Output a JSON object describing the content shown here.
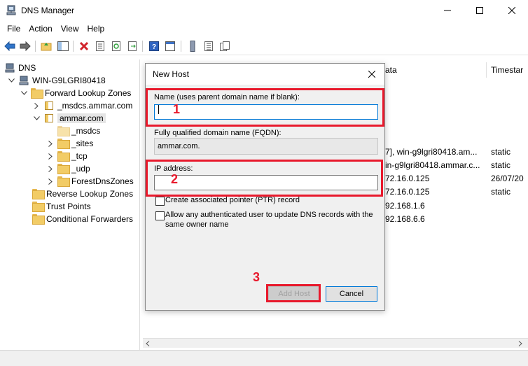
{
  "window": {
    "title": "DNS Manager",
    "app_icon": "dns-manager-icon"
  },
  "menu": [
    "File",
    "Action",
    "View",
    "Help"
  ],
  "tree": {
    "root": "DNS",
    "server": "WIN-G9LGRI80418",
    "forward_zones": "Forward Lookup Zones",
    "msdcs_zone": "_msdcs.ammar.com",
    "ammar_zone": "ammar.com",
    "msdcs": "_msdcs",
    "sites": "_sites",
    "tcp": "_tcp",
    "udp": "_udp",
    "forestdnszones": "ForestDnsZones",
    "reverse_zones": "Reverse Lookup Zones",
    "trust_points": "Trust Points",
    "conditional_forwarders": "Conditional Forwarders"
  },
  "list": {
    "col_data": "ata",
    "col_timestamp": "Timestar",
    "rows": [
      {
        "data": "7], win-g9lgri80418.am...",
        "timestamp": "static"
      },
      {
        "data": "in-g9lgri80418.ammar.c...",
        "timestamp": "static"
      },
      {
        "data": "72.16.0.125",
        "timestamp": "26/07/20"
      },
      {
        "data": "72.16.0.125",
        "timestamp": "static"
      },
      {
        "data": "92.168.1.6",
        "timestamp": ""
      },
      {
        "data": "92.168.6.6",
        "timestamp": ""
      }
    ]
  },
  "dialog": {
    "title": "New Host",
    "name_label": "Name (uses parent domain name if blank):",
    "name_value": "",
    "fqdn_label": "Fully qualified domain name (FQDN):",
    "fqdn_value": "ammar.com.",
    "ip_label": "IP address:",
    "ip_value": "",
    "ptr_label": "Create associated pointer (PTR) record",
    "auth_label_line1": "Allow any authenticated user to update DNS records with the",
    "auth_label_line2": "same owner name",
    "add_host": "Add Host",
    "cancel": "Cancel"
  },
  "annotations": [
    "1",
    "2",
    "3"
  ],
  "colors": {
    "annotation_red": "#e8192c",
    "folder_yellow": "#f2cc66",
    "focus_blue": "#0078d7",
    "dialog_bg": "#f0f0f0"
  }
}
